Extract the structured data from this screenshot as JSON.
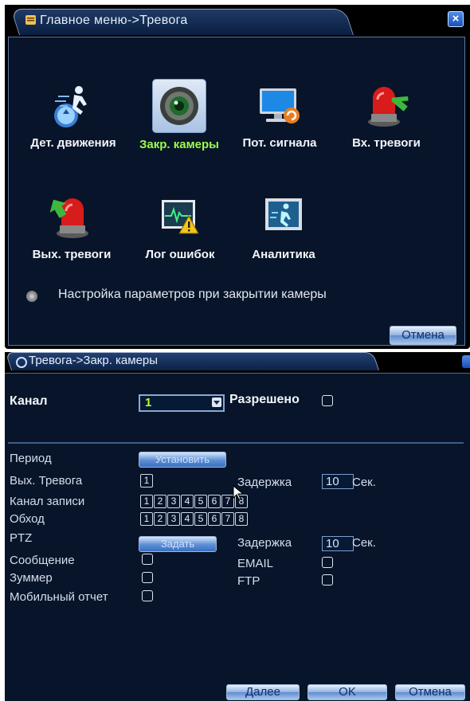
{
  "main_window": {
    "title": "Главное меню->Тревога",
    "items": [
      {
        "label": "Дет. движения",
        "icon": "motion-detect-icon",
        "active": false
      },
      {
        "label": "Закр. камеры",
        "icon": "camera-blind-icon",
        "active": true
      },
      {
        "label": "Пот. сигнала",
        "icon": "video-loss-icon",
        "active": false
      },
      {
        "label": "Вх. тревоги",
        "icon": "alarm-input-icon",
        "active": false
      },
      {
        "label": "Вых. тревоги",
        "icon": "alarm-output-icon",
        "active": false
      },
      {
        "label": "Лог ошибок",
        "icon": "error-log-icon",
        "active": false
      },
      {
        "label": "Аналитика",
        "icon": "analytics-icon",
        "active": false
      }
    ],
    "hint": "Настройка параметров при закрытии камеры",
    "cancel_label": "Отмена"
  },
  "blind_window": {
    "title": "Тревога->Закр. камеры",
    "channel_label": "Канал",
    "channel_value": "1",
    "enabled_label": "Разрешено",
    "period_label": "Период",
    "period_button": "Установить",
    "alarm_out_label": "Вых. Тревога",
    "alarm_out_value": "1",
    "delay_label": "Задержка",
    "delay1_value": "10",
    "delay2_value": "10",
    "sec_label": "Сек.",
    "record_label": "Канал записи",
    "tour_label": "Обход",
    "channels": [
      "1",
      "2",
      "3",
      "4",
      "5",
      "6",
      "7",
      "8"
    ],
    "ptz_label": "PTZ",
    "ptz_button": "Задать",
    "message_label": "Сообщение",
    "email_label": "EMAIL",
    "buzzer_label": "Зуммер",
    "ftp_label": "FTP",
    "mobile_label": "Мобильный отчет",
    "next_label": "Далее",
    "ok_label": "OK",
    "cancel_label": "Отмена"
  },
  "colors": {
    "panel": "#071429",
    "active_text": "#9efc4b",
    "channel_value": "#b6ff3a"
  }
}
